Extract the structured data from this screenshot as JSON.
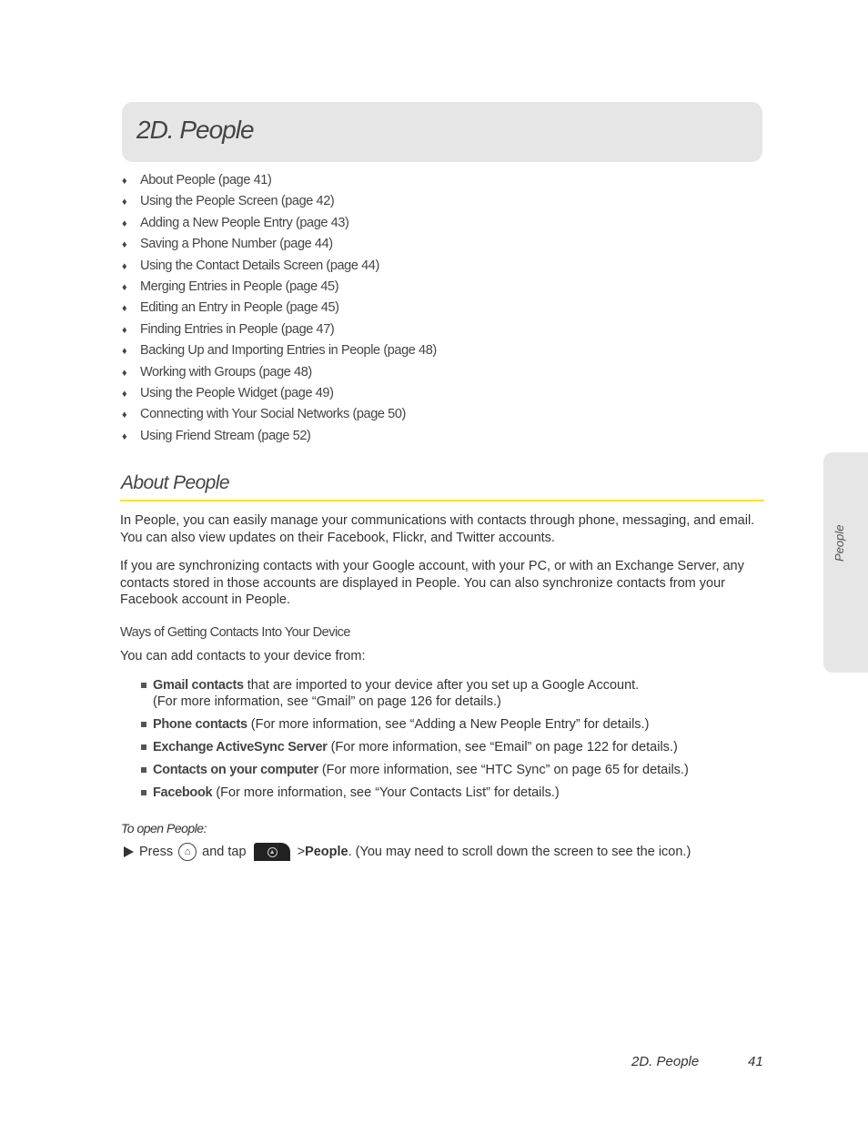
{
  "chapter": {
    "title": "2D. People"
  },
  "toc": [
    "About People (page 41)",
    "Using the People Screen (page 42)",
    "Adding a New People Entry (page 43)",
    "Saving a Phone Number (page 44)",
    "Using the Contact Details Screen (page 44)",
    "Merging Entries in People (page 45)",
    "Editing an Entry in People (page 45)",
    "Finding Entries in People (page 47)",
    "Backing Up and Importing Entries in People (page 48)",
    "Working with Groups (page 48)",
    "Using the People Widget (page 49)",
    "Connecting with Your Social Networks (page 50)",
    "Using Friend Stream (page 52)"
  ],
  "toc_bullet": "♦",
  "section": {
    "title": "About People",
    "paragraphs": [
      "In People, you can easily manage your communications with contacts through phone, messaging, and email. You can also view updates on their Facebook, Flickr, and Twitter accounts.",
      "If you are synchronizing contacts with your Google account, with your PC, or with an Exchange Server, any contacts stored in those accounts are displayed in People. You can also synchronize contacts from your Facebook account in People."
    ],
    "subheading": "Ways of Getting Contacts Into Your Device",
    "intro": "You can add contacts to your device from:",
    "bullets": [
      {
        "bold": "Gmail contacts",
        "text": " that are imported to your device after you set up a Google Account.",
        "text2": "(For more information, see “Gmail” on page 126 for details.)"
      },
      {
        "bold": "Phone contacts",
        "text": " (For more information, see “Adding a New People Entry” for details.)"
      },
      {
        "bold": "Exchange ActiveSync Server",
        "text": " (For more information, see “Email” on page 122 for details.)"
      },
      {
        "bold": "Contacts on your computer",
        "text": " (For more information, see “HTC Sync” on page 65 for details.)"
      },
      {
        "bold": "Facebook",
        "text": " (For more information, see “Your Contacts List” for details.)"
      }
    ],
    "procedure_label": "To open People:",
    "step": {
      "press": "Press",
      "and_tap": "and tap",
      "separator": ">",
      "target": "People",
      "note": ". (You may need to scroll down the screen to see the icon.)"
    }
  },
  "side_tab": {
    "label": "People"
  },
  "footer": {
    "section": "2D. People",
    "page": "41"
  },
  "colors": {
    "accent_rule": "#ffe500",
    "banner": "#e6e6e6"
  }
}
